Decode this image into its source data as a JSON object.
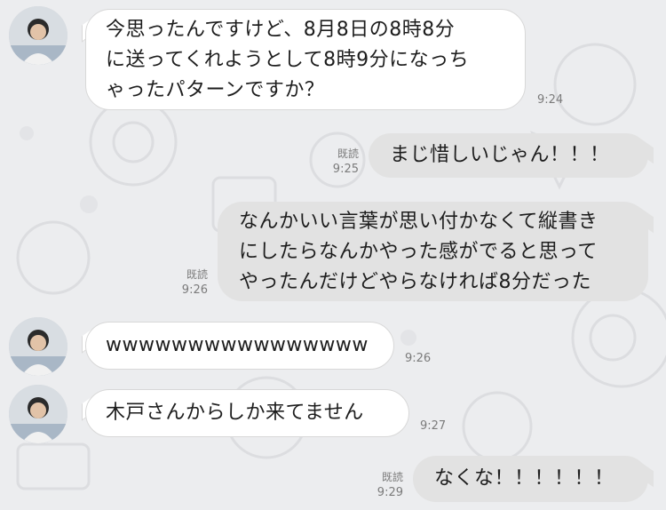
{
  "messages": [
    {
      "side": "in",
      "lines": [
        "今思ったんですけど、8月8日の8時8分",
        "に送ってくれようとして8時9分になっち",
        "ゃったパターンですか？"
      ],
      "time": "9:24",
      "read": ""
    },
    {
      "side": "out",
      "lines": [
        "まじ惜しいじゃん！！！"
      ],
      "time": "9:25",
      "read": "既読"
    },
    {
      "side": "out",
      "lines": [
        "なんかいい言葉が思い付かなくて縦書き",
        "にしたらなんかやった感がでると思って",
        "やったんだけどやらなければ8分だった"
      ],
      "time": "9:26",
      "read": "既読"
    },
    {
      "side": "in",
      "lines": [
        "wwwwwwwwwwwwwwww"
      ],
      "time": "9:26",
      "read": ""
    },
    {
      "side": "in",
      "lines": [
        "木戸さんからしか来てません"
      ],
      "time": "9:27",
      "read": ""
    },
    {
      "side": "out",
      "lines": [
        "なくな！！！！！！"
      ],
      "time": "9:29",
      "read": "既読"
    }
  ],
  "colors": {
    "background": "#ecedef",
    "incoming": "#ffffff",
    "outgoing": "#e2e2e2",
    "meta": "#7b7b7b"
  },
  "icons": {
    "avatar": "contact-avatar",
    "background": "doodle-pattern"
  }
}
